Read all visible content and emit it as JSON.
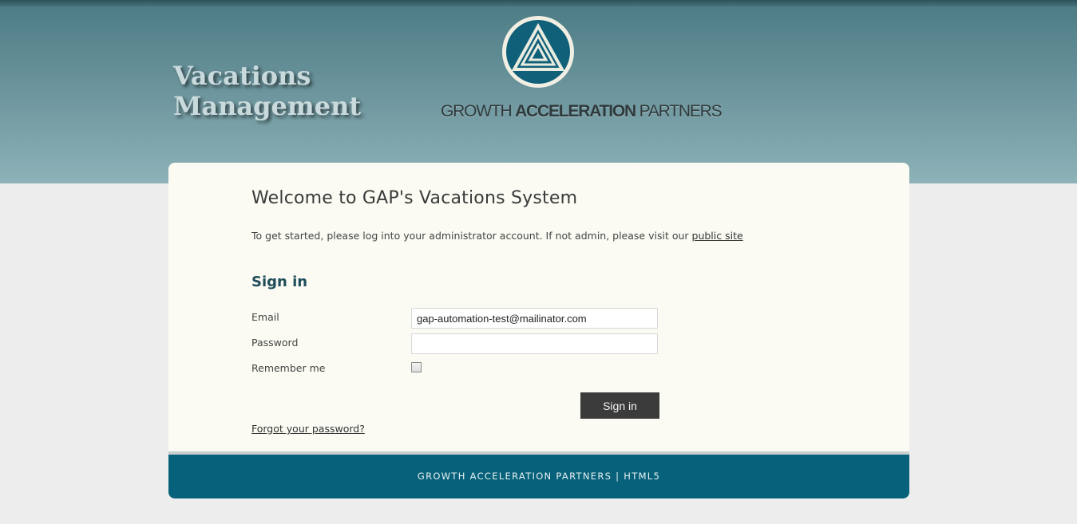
{
  "header": {
    "title_line1": "Vacations",
    "title_line2": "Management",
    "brand_word1": "GROWTH ",
    "brand_word2": "ACCELERATION",
    "brand_word3": " PARTNERS",
    "colors": {
      "band_top": "#3f6b73",
      "band_bottom": "#8db2b8",
      "logo_fill": "#11607a"
    }
  },
  "main": {
    "welcome": "Welcome to GAP's Vacations System",
    "intro_text": "To get started, please log into your administrator account. If not admin, please visit our ",
    "public_site_link": "public site",
    "signin_heading": "Sign in",
    "email_label": "Email",
    "email_value": "gap-automation-test@mailinator.com",
    "password_label": "Password",
    "password_value": "",
    "remember_label": "Remember me",
    "remember_checked": false,
    "signin_button": "Sign in",
    "forgot_link": "Forgot your password?"
  },
  "footer": {
    "text": "GROWTH ACCELERATION PARTNERS  |  HTML5",
    "color": "#07617a"
  }
}
